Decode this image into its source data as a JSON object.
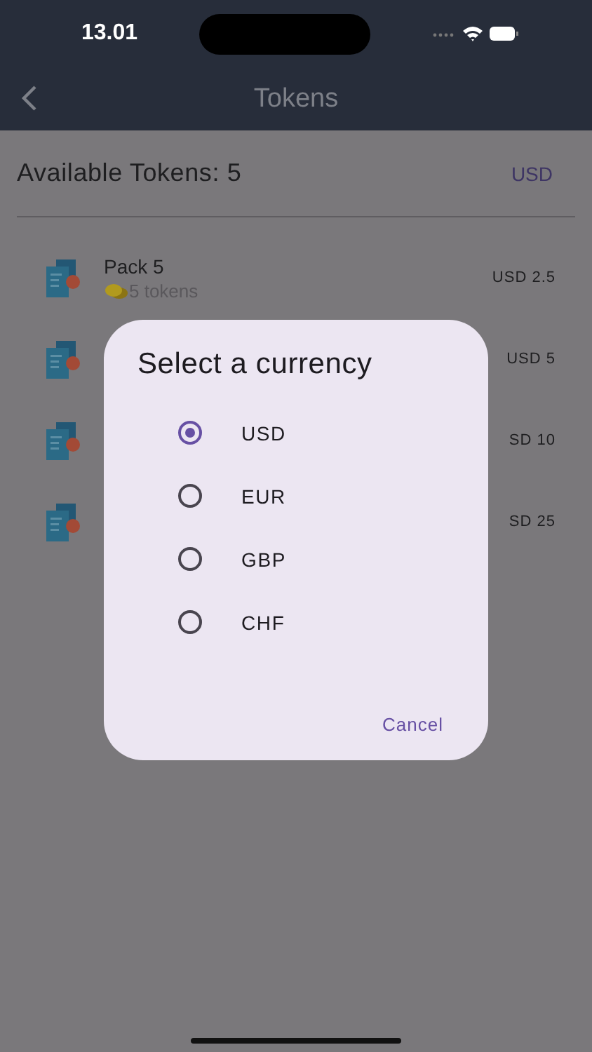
{
  "status_bar": {
    "time": "13.01"
  },
  "nav": {
    "title": "Tokens"
  },
  "header": {
    "available": "Available Tokens: 5",
    "currency": "USD"
  },
  "packs": [
    {
      "name": "Pack 5",
      "subtitle": "5 tokens",
      "price": "USD 2.5"
    },
    {
      "price": "USD 5"
    },
    {
      "price": "SD 10"
    },
    {
      "price": "SD 25"
    }
  ],
  "dialog": {
    "title": "Select a currency",
    "options": [
      {
        "label": "USD",
        "selected": true
      },
      {
        "label": "EUR",
        "selected": false
      },
      {
        "label": "GBP",
        "selected": false
      },
      {
        "label": "CHF",
        "selected": false
      }
    ],
    "cancel": "Cancel"
  }
}
